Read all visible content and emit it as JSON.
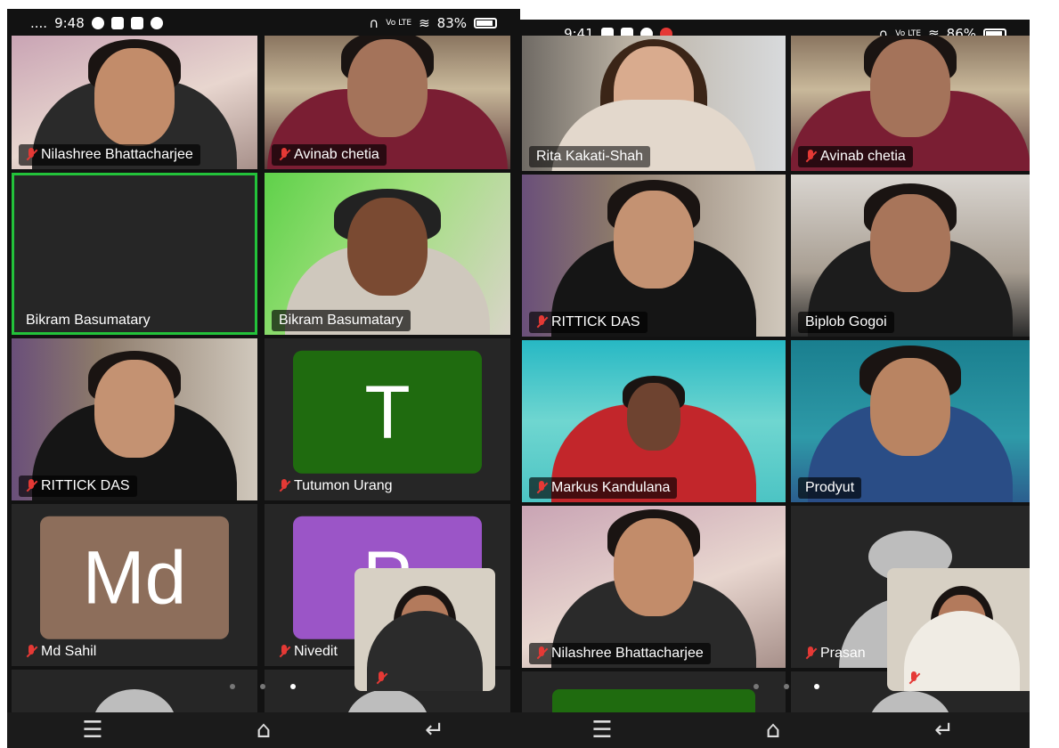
{
  "left": {
    "status": {
      "time": "9:48",
      "battery": "83%"
    },
    "tiles": {
      "t1": "Nilashree Bhattacharjee",
      "t2": "Avinab chetia",
      "t3": "Bikram Basumatary",
      "t4": "Bikram Basumatary",
      "t5": "RITTICK DAS",
      "t6": "Tutumon Urang",
      "t7": "Md Sahil",
      "t8": "Nivedit"
    },
    "avatars": {
      "t6": "T",
      "t7": "Md",
      "t8": "P"
    }
  },
  "right": {
    "status": {
      "time": "9:41",
      "battery": "86%"
    },
    "tiles": {
      "t1": "Rita Kakati-Shah",
      "t2": "Avinab chetia",
      "t3": "RITTICK DAS",
      "t4": "Biplob Gogoi",
      "t5": "Markus Kandulana",
      "t6": "Prodyut",
      "t7": "Nilashree Bhattacharjee",
      "t8": "Prasan"
    }
  },
  "colors": {
    "active_speaker": "#23c23a",
    "avatar_t": "#1f6b0f",
    "avatar_md": "#8d6e5b",
    "avatar_p": "#9b55c7",
    "muted": "#e53935"
  },
  "icons": [
    "signal-icon",
    "whatsapp-icon",
    "wifi-icon",
    "battery-icon",
    "headphones-icon",
    "mic-off-icon",
    "menu-icon",
    "home-icon",
    "back-icon"
  ]
}
